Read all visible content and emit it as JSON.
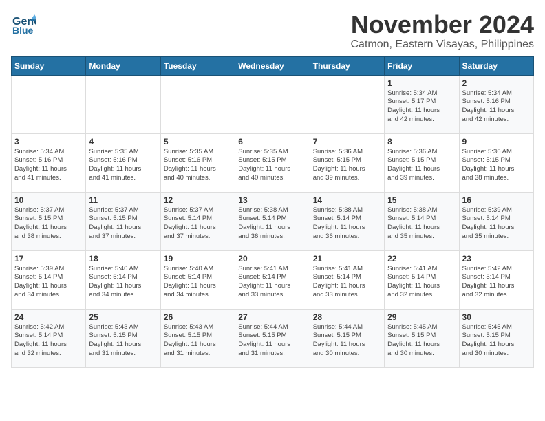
{
  "header": {
    "logo_line1": "General",
    "logo_line2": "Blue",
    "title": "November 2024",
    "subtitle": "Catmon, Eastern Visayas, Philippines"
  },
  "days_of_week": [
    "Sunday",
    "Monday",
    "Tuesday",
    "Wednesday",
    "Thursday",
    "Friday",
    "Saturday"
  ],
  "weeks": [
    [
      {
        "day": "",
        "info": ""
      },
      {
        "day": "",
        "info": ""
      },
      {
        "day": "",
        "info": ""
      },
      {
        "day": "",
        "info": ""
      },
      {
        "day": "",
        "info": ""
      },
      {
        "day": "1",
        "info": "Sunrise: 5:34 AM\nSunset: 5:17 PM\nDaylight: 11 hours\nand 42 minutes."
      },
      {
        "day": "2",
        "info": "Sunrise: 5:34 AM\nSunset: 5:16 PM\nDaylight: 11 hours\nand 42 minutes."
      }
    ],
    [
      {
        "day": "3",
        "info": "Sunrise: 5:34 AM\nSunset: 5:16 PM\nDaylight: 11 hours\nand 41 minutes."
      },
      {
        "day": "4",
        "info": "Sunrise: 5:35 AM\nSunset: 5:16 PM\nDaylight: 11 hours\nand 41 minutes."
      },
      {
        "day": "5",
        "info": "Sunrise: 5:35 AM\nSunset: 5:16 PM\nDaylight: 11 hours\nand 40 minutes."
      },
      {
        "day": "6",
        "info": "Sunrise: 5:35 AM\nSunset: 5:15 PM\nDaylight: 11 hours\nand 40 minutes."
      },
      {
        "day": "7",
        "info": "Sunrise: 5:36 AM\nSunset: 5:15 PM\nDaylight: 11 hours\nand 39 minutes."
      },
      {
        "day": "8",
        "info": "Sunrise: 5:36 AM\nSunset: 5:15 PM\nDaylight: 11 hours\nand 39 minutes."
      },
      {
        "day": "9",
        "info": "Sunrise: 5:36 AM\nSunset: 5:15 PM\nDaylight: 11 hours\nand 38 minutes."
      }
    ],
    [
      {
        "day": "10",
        "info": "Sunrise: 5:37 AM\nSunset: 5:15 PM\nDaylight: 11 hours\nand 38 minutes."
      },
      {
        "day": "11",
        "info": "Sunrise: 5:37 AM\nSunset: 5:15 PM\nDaylight: 11 hours\nand 37 minutes."
      },
      {
        "day": "12",
        "info": "Sunrise: 5:37 AM\nSunset: 5:14 PM\nDaylight: 11 hours\nand 37 minutes."
      },
      {
        "day": "13",
        "info": "Sunrise: 5:38 AM\nSunset: 5:14 PM\nDaylight: 11 hours\nand 36 minutes."
      },
      {
        "day": "14",
        "info": "Sunrise: 5:38 AM\nSunset: 5:14 PM\nDaylight: 11 hours\nand 36 minutes."
      },
      {
        "day": "15",
        "info": "Sunrise: 5:38 AM\nSunset: 5:14 PM\nDaylight: 11 hours\nand 35 minutes."
      },
      {
        "day": "16",
        "info": "Sunrise: 5:39 AM\nSunset: 5:14 PM\nDaylight: 11 hours\nand 35 minutes."
      }
    ],
    [
      {
        "day": "17",
        "info": "Sunrise: 5:39 AM\nSunset: 5:14 PM\nDaylight: 11 hours\nand 34 minutes."
      },
      {
        "day": "18",
        "info": "Sunrise: 5:40 AM\nSunset: 5:14 PM\nDaylight: 11 hours\nand 34 minutes."
      },
      {
        "day": "19",
        "info": "Sunrise: 5:40 AM\nSunset: 5:14 PM\nDaylight: 11 hours\nand 34 minutes."
      },
      {
        "day": "20",
        "info": "Sunrise: 5:41 AM\nSunset: 5:14 PM\nDaylight: 11 hours\nand 33 minutes."
      },
      {
        "day": "21",
        "info": "Sunrise: 5:41 AM\nSunset: 5:14 PM\nDaylight: 11 hours\nand 33 minutes."
      },
      {
        "day": "22",
        "info": "Sunrise: 5:41 AM\nSunset: 5:14 PM\nDaylight: 11 hours\nand 32 minutes."
      },
      {
        "day": "23",
        "info": "Sunrise: 5:42 AM\nSunset: 5:14 PM\nDaylight: 11 hours\nand 32 minutes."
      }
    ],
    [
      {
        "day": "24",
        "info": "Sunrise: 5:42 AM\nSunset: 5:14 PM\nDaylight: 11 hours\nand 32 minutes."
      },
      {
        "day": "25",
        "info": "Sunrise: 5:43 AM\nSunset: 5:15 PM\nDaylight: 11 hours\nand 31 minutes."
      },
      {
        "day": "26",
        "info": "Sunrise: 5:43 AM\nSunset: 5:15 PM\nDaylight: 11 hours\nand 31 minutes."
      },
      {
        "day": "27",
        "info": "Sunrise: 5:44 AM\nSunset: 5:15 PM\nDaylight: 11 hours\nand 31 minutes."
      },
      {
        "day": "28",
        "info": "Sunrise: 5:44 AM\nSunset: 5:15 PM\nDaylight: 11 hours\nand 30 minutes."
      },
      {
        "day": "29",
        "info": "Sunrise: 5:45 AM\nSunset: 5:15 PM\nDaylight: 11 hours\nand 30 minutes."
      },
      {
        "day": "30",
        "info": "Sunrise: 5:45 AM\nSunset: 5:15 PM\nDaylight: 11 hours\nand 30 minutes."
      }
    ]
  ]
}
